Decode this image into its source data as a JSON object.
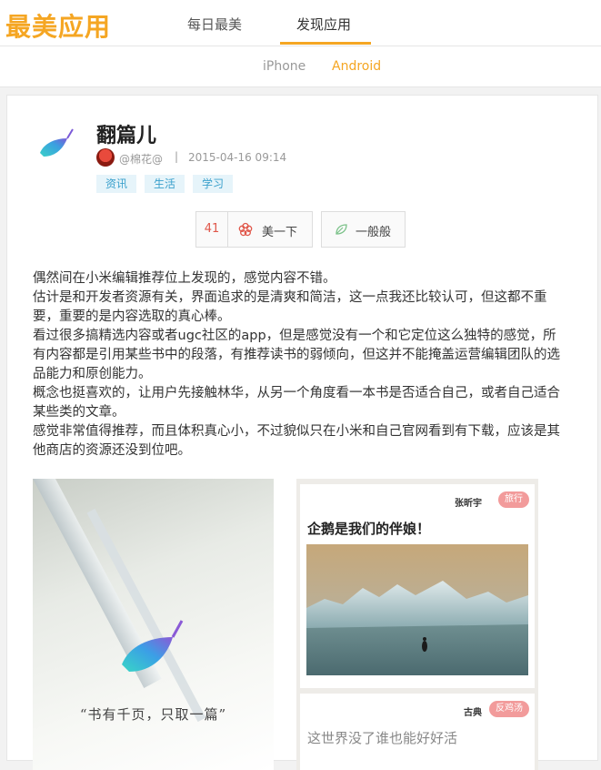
{
  "header": {
    "logo": "最美应用",
    "tabs": [
      {
        "label": "每日最美"
      },
      {
        "label": "发现应用"
      }
    ],
    "active_tab": "发现应用"
  },
  "subnav": {
    "tabs": [
      {
        "label": "iPhone"
      },
      {
        "label": "Android"
      }
    ],
    "active_tab": "Android"
  },
  "post": {
    "title": "翻篇儿",
    "author": "@棉花@",
    "separator": "|",
    "time": "2015-04-16 09:14",
    "tags": [
      "资讯",
      "生活",
      "学习"
    ],
    "like_count": "41",
    "like_label": "美一下",
    "meh_label": "一般般",
    "paragraphs": [
      "偶然间在小米编辑推荐位上发现的，感觉内容不错。",
      "估计是和开发者资源有关，界面追求的是清爽和简洁，这一点我还比较认可，但这都不重要，重要的是内容选取的真心棒。",
      "看过很多搞精选内容或者ugc社区的app，但是感觉没有一个和它定位这么独特的感觉，所有内容都是引用某些书中的段落，有推荐读书的弱倾向，但这并不能掩盖运营编辑团队的选品能力和原创能力。",
      "概念也挺喜欢的，让用户先接触林华，从另一个角度看一本书是否适合自己，或者自己适合某些类的文章。",
      "感觉非常值得推荐，而且体积真心小，不过貌似只在小米和自己官网看到有下载，应该是其他商店的资源还没到位吧。"
    ]
  },
  "screenshot_left": {
    "quote": "“书有千页，只取一篇”"
  },
  "screenshot_right": {
    "card1": {
      "author": "张昕宇",
      "tag": "旅行",
      "title": "企鹅是我们的伴娘！"
    },
    "card2": {
      "author": "古典",
      "tag": "反鸡汤",
      "title": "这世界没了谁也能好好活"
    }
  },
  "colors": {
    "accent": "#f5a623",
    "tag_bg": "#e6f4fa",
    "tag_text": "#3aa0cc",
    "like_count": "#e0574a",
    "pill": "#f29b9b"
  }
}
